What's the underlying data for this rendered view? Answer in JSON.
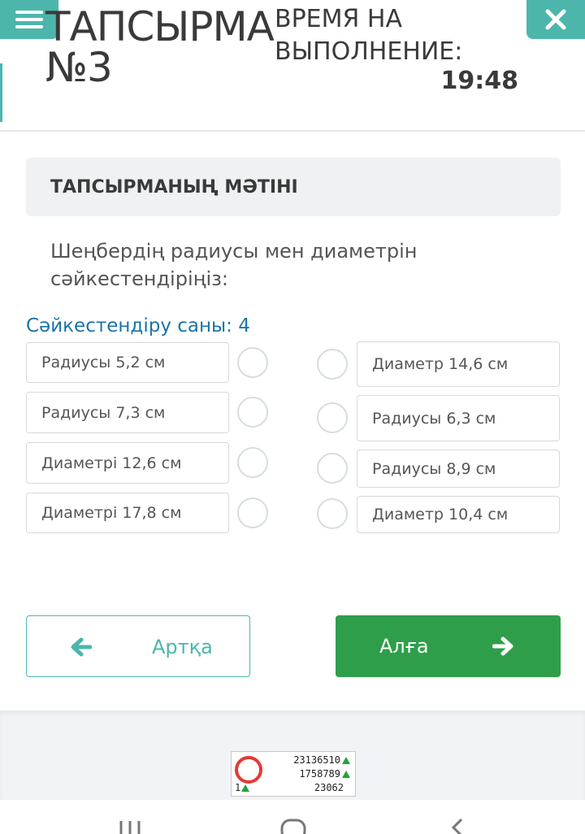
{
  "header": {
    "title_line1": "ТАПСЫРМА",
    "title_line2": "№3",
    "time_label_line1": "ВРЕМЯ НА",
    "time_label_line2": "ВЫПОЛНЕНИЕ:",
    "time_value": "19:48"
  },
  "section": {
    "heading": "ТАПСЫРМАНЫҢ МӘТІНІ",
    "question": "Шеңбердің радиусы мен диаметрін сәйкестендіріңіз:",
    "match_count": "Сәйкестендіру саны: 4"
  },
  "left_options": [
    "Радиусы 5,2 см",
    "Радиусы 7,3 см",
    "Диаметрі 12,6 см",
    "Диаметрі 17,8 см"
  ],
  "right_options": [
    "Диаметр 14,6 см",
    "Радиусы 6,3 см",
    "Радиусы 8,9 см",
    "Диаметр 10,4 см"
  ],
  "buttons": {
    "back": "Артқа",
    "next": "Алға"
  },
  "counter": {
    "line1": "23136510",
    "line2": "1758789",
    "line3": "23062",
    "online": "1"
  },
  "colors": {
    "accent": "#4db6ac",
    "next_button": "#2e9e4a",
    "count_text": "#1a73a8"
  },
  "icons": {
    "menu": "hamburger-icon",
    "close": "close-icon",
    "back": "arrow-left-icon",
    "next": "arrow-right-icon"
  }
}
